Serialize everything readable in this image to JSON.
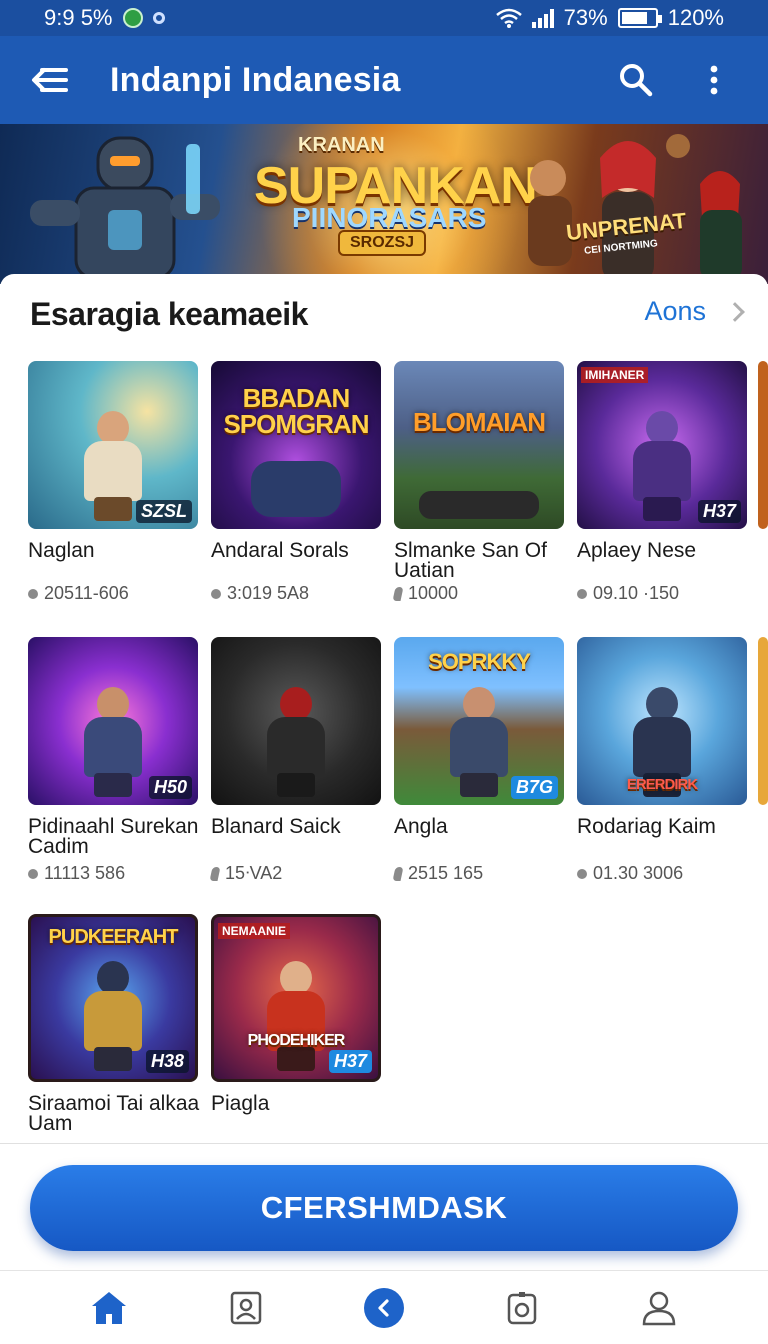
{
  "status_bar": {
    "time": "9:9 5%",
    "signal_text": "73%",
    "battery_text": "120%"
  },
  "app_bar": {
    "title": "Indanpi Indanesia",
    "menu_icon": "hamburger-menu-icon",
    "search_icon": "search-icon",
    "more_icon": "more-vertical-icon"
  },
  "banner": {
    "small_text": "KRANAN",
    "title": "SUPANKAN",
    "subtitle": "PIINORASARS",
    "badge": "SROZSJ",
    "right_text": "UNPRENAT",
    "right_sub": "CEI NORTMING"
  },
  "section": {
    "title": "Esaragia keamaeik",
    "see_all": "Aons"
  },
  "games": [
    {
      "name": "Naglan",
      "meta": "20511-606",
      "meta_icon": "dot",
      "thumb_label": "",
      "corner": "SZSL",
      "tag": ""
    },
    {
      "name": "Andaral Sorals",
      "meta": "3:019 5A8",
      "meta_icon": "dot",
      "thumb_label": "BBADAN SPOMGRAN",
      "corner": "",
      "tag": ""
    },
    {
      "name": "Slmanke San Of Uatian",
      "meta": "10000",
      "meta_icon": "pin",
      "thumb_label": "BLOMAIAN",
      "corner": "",
      "tag": ""
    },
    {
      "name": "Aplaey Nese",
      "meta": "09.10 ·150",
      "meta_icon": "dot",
      "thumb_label": "",
      "corner": "H37",
      "tag": "IMIHANER"
    },
    {
      "name": "Pidinaahl Surekan Cadim",
      "meta": "11113 586",
      "meta_icon": "dot",
      "thumb_label": "",
      "corner": "H50",
      "tag": ""
    },
    {
      "name": "Blanard Saick",
      "meta": "15ᐧVA2",
      "meta_icon": "pin",
      "thumb_label": "",
      "corner": "",
      "tag": ""
    },
    {
      "name": "Angla",
      "meta": "2515 165",
      "meta_icon": "pin",
      "thumb_label": "SOPRKKY",
      "corner": "B7G",
      "tag": ""
    },
    {
      "name": "Rodariag Kaim",
      "meta": "01.30 3006",
      "meta_icon": "dot",
      "thumb_label": "ERERDIRK",
      "corner": "",
      "tag": ""
    },
    {
      "name": "Siraamoi Tai alkaa Uam",
      "meta": "",
      "meta_icon": "",
      "thumb_label": "PUDKEERAHT",
      "corner": "H38",
      "tag": ""
    },
    {
      "name": "Piagla",
      "meta": "",
      "meta_icon": "",
      "thumb_label": "PHODEHIKER",
      "corner": "H37",
      "tag": "NEMAANIE"
    }
  ],
  "cta": {
    "label": "CFERSHMDASK"
  },
  "nav": [
    {
      "icon": "home-icon",
      "active": true
    },
    {
      "icon": "contact-card-icon",
      "active": false
    },
    {
      "icon": "back-chevron-icon",
      "active": false
    },
    {
      "icon": "camera-icon",
      "active": false
    },
    {
      "icon": "profile-icon",
      "active": false
    }
  ],
  "colors": {
    "primary": "#1e5ab4",
    "accent": "#1e73d6",
    "cta": "#1e63c9"
  }
}
